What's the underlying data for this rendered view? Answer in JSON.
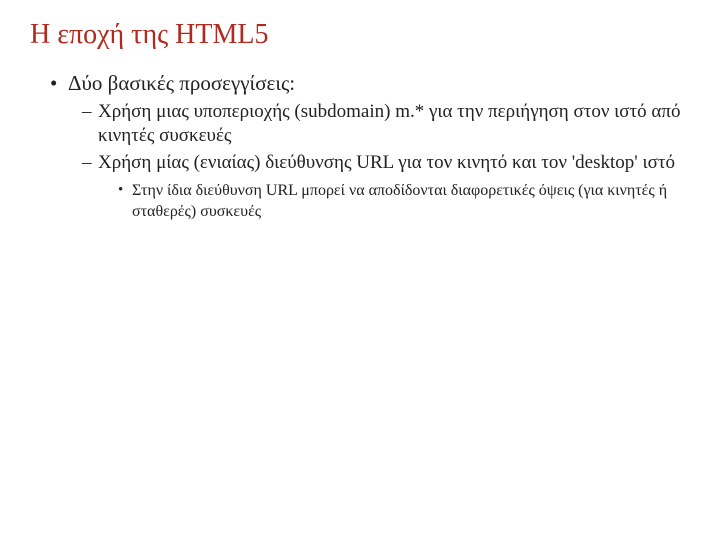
{
  "title": "Η εποχή της HTML5",
  "bullets": {
    "l1_0": "Δύο βασικές προσεγγίσεις:",
    "l2_0": "Χρήση μιας υποπεριοχής  (subdomain) m.* για την περιήγηση στον ιστό από κινητές συσκευές",
    "l2_1": "Χρήση μίας (ενιαίας) διεύθυνσης URL για τον κινητό και τον 'desktop' ιστό",
    "l3_0": "Στην ίδια διεύθυνση URL μπορεί να αποδίδονται διαφορετικές όψεις (για κινητές ή σταθερές) συσκευές"
  }
}
